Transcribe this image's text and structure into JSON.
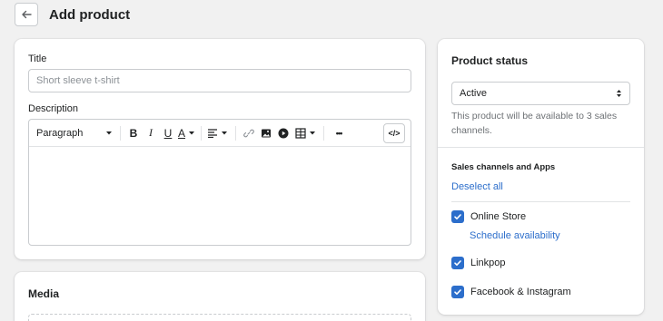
{
  "header": {
    "title": "Add product"
  },
  "main": {
    "title_label": "Title",
    "title_placeholder": "Short sleeve t-shirt",
    "description_label": "Description",
    "toolbar": {
      "format_select": "Paragraph",
      "bold": "B",
      "italic": "I",
      "underline": "U",
      "text_color": "A",
      "more": "•••",
      "code": "</>"
    }
  },
  "media": {
    "title": "Media"
  },
  "status": {
    "title": "Product status",
    "select_value": "Active",
    "help_text": "This product will be available to 3 sales channels.",
    "channels_title": "Sales channels and Apps",
    "deselect_all": "Deselect all",
    "channels": [
      {
        "label": "Online Store",
        "checked": true
      },
      {
        "label": "Linkpop",
        "checked": true
      },
      {
        "label": "Facebook & Instagram",
        "checked": true
      }
    ],
    "schedule_link": "Schedule availability"
  },
  "colors": {
    "accent": "#2c6ecb",
    "background": "#f1f1f1"
  }
}
